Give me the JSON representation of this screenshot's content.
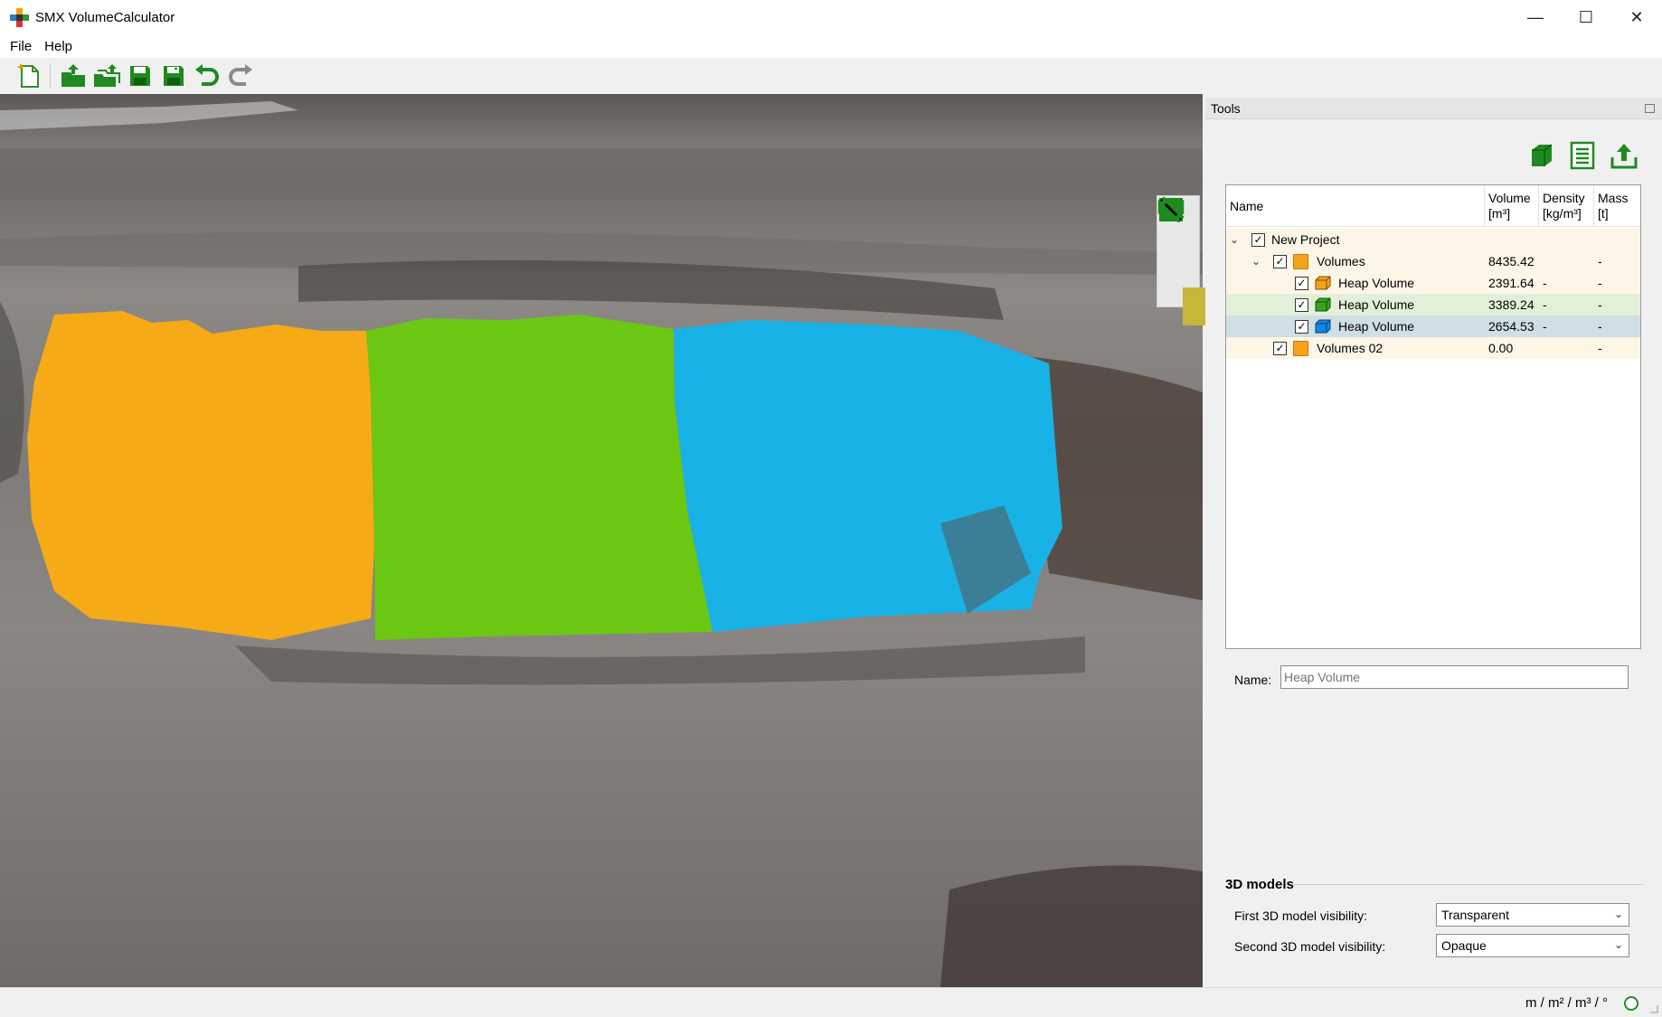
{
  "window": {
    "title": "SMX VolumeCalculator",
    "minimize_glyph": "—",
    "maximize_glyph": "☐",
    "close_glyph": "✕"
  },
  "menu": [
    "File",
    "Help"
  ],
  "toolbar": {
    "icons": [
      "new-project-icon",
      "open-icon",
      "open-multiple-icon",
      "save-icon",
      "save-as-icon",
      "undo-icon",
      "redo-icon"
    ]
  },
  "viewport": {
    "tools": [
      "camera-icon",
      "measure-icon",
      "crop-icon"
    ],
    "volumes": [
      {
        "color": "#f5aa16"
      },
      {
        "color": "#6cc712"
      },
      {
        "color": "#19b2e6"
      }
    ]
  },
  "tools_panel": {
    "title": "Tools",
    "actions": [
      "add-volume-icon",
      "report-icon",
      "export-icon"
    ],
    "columns": {
      "name": "Name",
      "volume_1": "Volume",
      "volume_2": "[m³]",
      "density_1": "Density",
      "density_2": "[kg/m³]",
      "mass_1": "Mass",
      "mass_2": "[t]"
    },
    "rows": [
      {
        "name": "New Project",
        "volume": "",
        "density": "",
        "mass": "",
        "checked": true
      },
      {
        "name": "Volumes",
        "volume": "8435.42",
        "density": "",
        "mass": "-",
        "checked": true
      },
      {
        "name": "Heap Volume",
        "volume": "2391.64",
        "density": "-",
        "mass": "-",
        "checked": true,
        "color": "#f5a21b"
      },
      {
        "name": "Heap Volume",
        "volume": "3389.24",
        "density": "-",
        "mass": "-",
        "checked": true,
        "color": "#39a41f"
      },
      {
        "name": "Heap Volume",
        "volume": "2654.53",
        "density": "-",
        "mass": "-",
        "checked": true,
        "color": "#1486e0"
      },
      {
        "name": "Volumes 02",
        "volume": "0.00",
        "density": "",
        "mass": "-",
        "checked": true
      }
    ],
    "name_label": "Name:",
    "name_placeholder": "Heap Volume",
    "models_section": "3D models",
    "first_visibility_label": "First 3D model visibility:",
    "first_visibility_value": "Transparent",
    "second_visibility_label": "Second 3D model visibility:",
    "second_visibility_value": "Opaque"
  },
  "status": {
    "units": "m / m² / m³ / °"
  },
  "highlight_arrow_color": "#c8b53a"
}
